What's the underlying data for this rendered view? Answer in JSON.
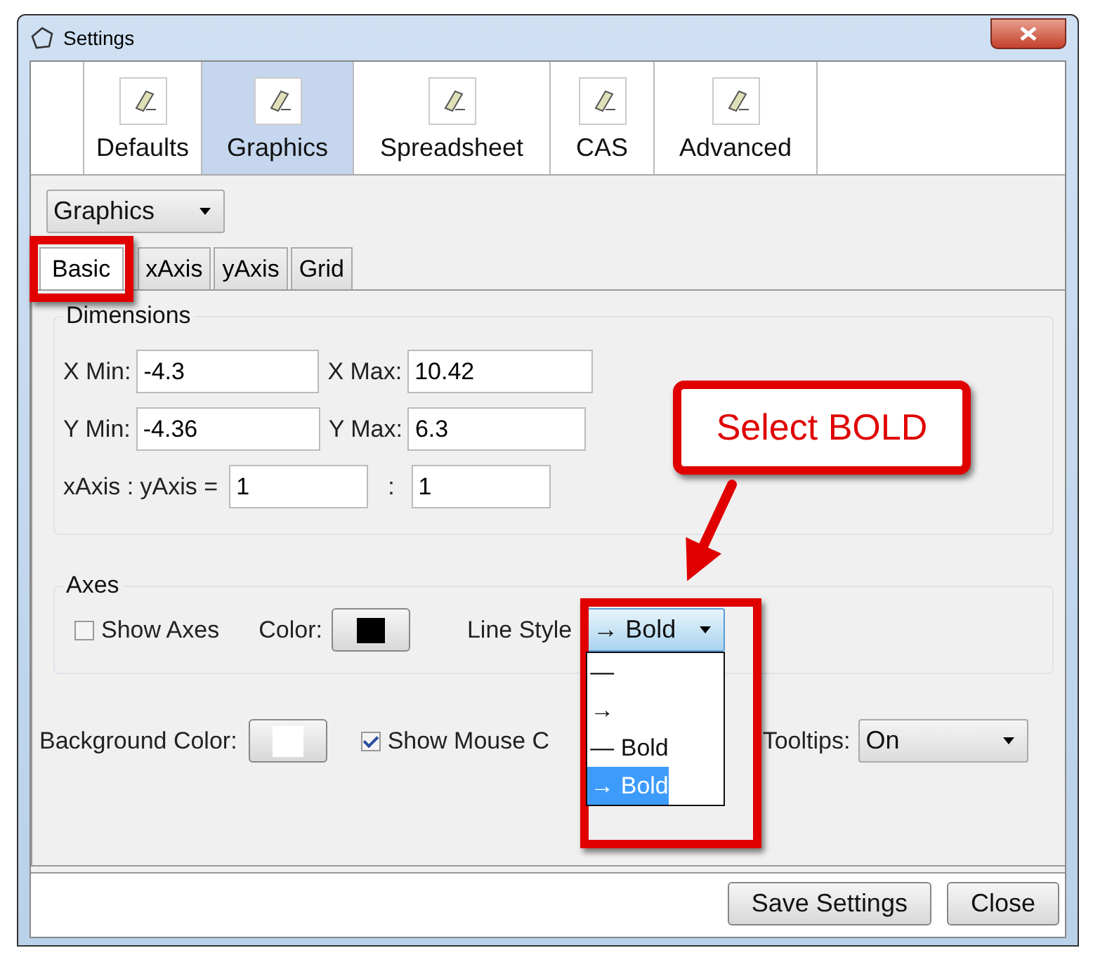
{
  "window": {
    "title": "Settings"
  },
  "category_tabs": [
    {
      "label": "Defaults",
      "selected": false
    },
    {
      "label": "Graphics",
      "selected": true
    },
    {
      "label": "Spreadsheet",
      "selected": false
    },
    {
      "label": "CAS",
      "selected": false
    },
    {
      "label": "Advanced",
      "selected": false
    }
  ],
  "view_select": {
    "value": "Graphics"
  },
  "subtabs": [
    {
      "label": "Basic",
      "selected": true
    },
    {
      "label": "xAxis",
      "selected": false
    },
    {
      "label": "yAxis",
      "selected": false
    },
    {
      "label": "Grid",
      "selected": false
    }
  ],
  "dimensions": {
    "title": "Dimensions",
    "rows": [
      {
        "fields": [
          {
            "label": "X Min:",
            "value": "-4.3"
          },
          {
            "label": "X Max:",
            "value": "10.42"
          }
        ]
      },
      {
        "fields": [
          {
            "label": "Y Min:",
            "value": "-4.36"
          },
          {
            "label": "Y Max:",
            "value": "6.3"
          }
        ]
      },
      {
        "fields": [
          {
            "label": "xAxis : yAxis =",
            "value": "1"
          },
          {
            "label": ":",
            "value": "1"
          }
        ]
      }
    ]
  },
  "axes": {
    "title": "Axes",
    "show_axes": {
      "label": "Show Axes",
      "checked": false
    },
    "color_label": "Color:",
    "color": "#000000",
    "line_style_label": "Line Style",
    "line_style": {
      "value": "→ Bold",
      "expanded": true,
      "options": [
        {
          "label": "—",
          "selected": false
        },
        {
          "label": "→",
          "selected": false
        },
        {
          "label": "— Bold",
          "selected": false
        },
        {
          "label": "→ Bold",
          "selected": true
        }
      ]
    }
  },
  "background": {
    "label": "Background Color:",
    "color": "#ffffff"
  },
  "show_mouse": {
    "label": "Show Mouse C",
    "checked": true
  },
  "tooltips": {
    "label": "Tooltips:",
    "value": "On"
  },
  "buttons": [
    "Save Settings",
    "Close"
  ],
  "callout": {
    "text": "Select BOLD"
  }
}
